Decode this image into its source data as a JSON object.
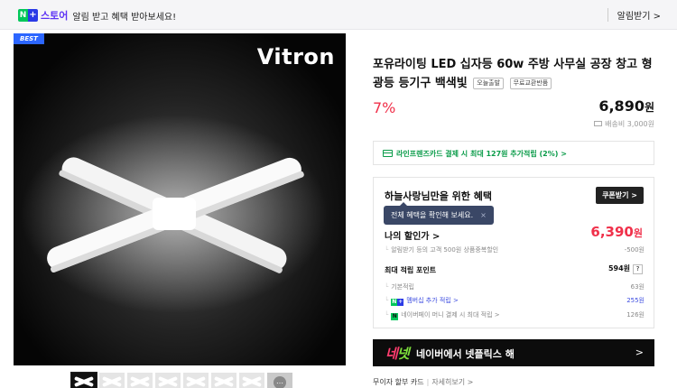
{
  "banner": {
    "badge_n": "N",
    "badge_plus": "+",
    "store_word": "스토어",
    "message": "알림 받고 혜택 받아보세요!",
    "alarm_button": "알림받기 >"
  },
  "image": {
    "best_label": "BEST",
    "brand_logo": "Vitron",
    "thumbnail_count": 8,
    "more_icon": "more-dots-icon"
  },
  "product": {
    "title": "포유라이팅 LED 십자등 60w 주방 사무실 공장 창고 형광등 등기구 백색빛",
    "tags": [
      "오늘출발",
      "무료교환반품"
    ],
    "discount": "7%",
    "price": "6,890",
    "price_unit": "원",
    "shipping": "배송비 3,000원"
  },
  "card_benefit": {
    "text": "라인프렌즈카드 결제 시 최대 127원 추가적립 (2%) >"
  },
  "benefits": {
    "title": "하늘사랑님만을 위한 혜택",
    "coupon_button": "쿠폰받기 >",
    "tooltip": "전체 혜택을 확인해 보세요.",
    "tooltip_close": "×",
    "my_discount_label": "나의 할인가 >",
    "my_discount_price": "6,390",
    "my_discount_unit": "원",
    "discount_detail_label": "알림받기 등의 고객 500원 상품중복할인",
    "discount_detail_value": "-500원",
    "points_label": "최대 적립 포인트",
    "points_value": "594원",
    "points_help": "?",
    "basic_label": "기본적립",
    "basic_value": "63원",
    "membership_label": "멤버십 추가 적립 >",
    "membership_value": "255원",
    "naverpay_label": "네이버페이 머니 결제 시 최대 적립 >",
    "naverpay_value": "126원",
    "n_icon": "N"
  },
  "promo": {
    "logo_left": "네",
    "logo_right": "넷",
    "text": "네이버에서 넷플릭스 해",
    "arrow": ">"
  },
  "installment": {
    "label": "무이자 할부 카드",
    "link": "자세히보기 >"
  }
}
